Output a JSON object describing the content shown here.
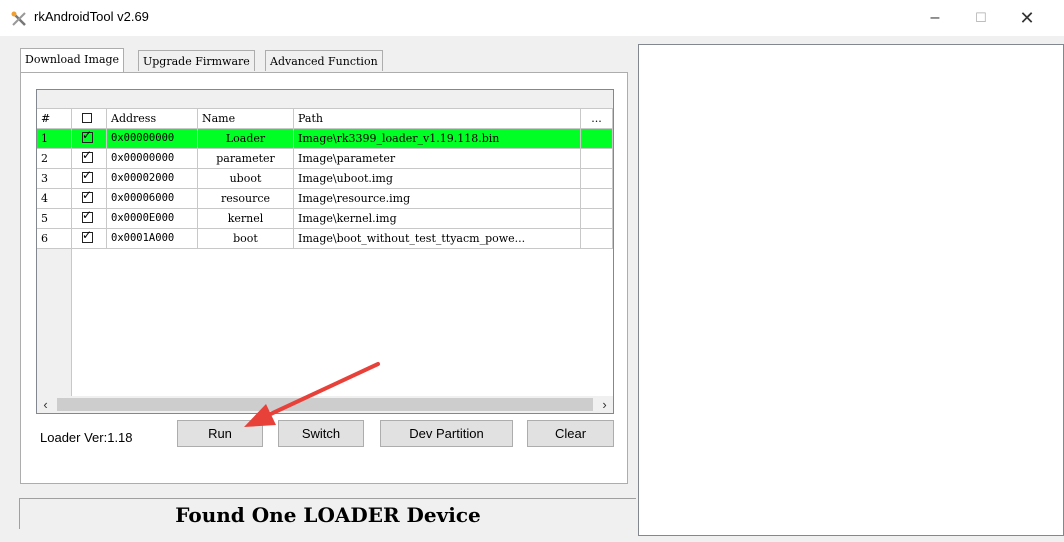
{
  "window": {
    "title": "rkAndroidTool v2.69",
    "controls": {
      "minimize": "–",
      "maximize": "☐",
      "close": "✕"
    }
  },
  "tabs": [
    {
      "label": "Download Image",
      "active": true
    },
    {
      "label": "Upgrade Firmware",
      "active": false
    },
    {
      "label": "Advanced Function",
      "active": false
    }
  ],
  "table": {
    "headers": {
      "num": "#",
      "address": "Address",
      "name": "Name",
      "path": "Path",
      "more": "..."
    },
    "rows": [
      {
        "num": "1",
        "checked": true,
        "address": "0x00000000",
        "name": "Loader",
        "path": "Image\\rk3399_loader_v1.19.118.bin",
        "selected": true
      },
      {
        "num": "2",
        "checked": true,
        "address": "0x00000000",
        "name": "parameter",
        "path": "Image\\parameter",
        "selected": false
      },
      {
        "num": "3",
        "checked": true,
        "address": "0x00002000",
        "name": "uboot",
        "path": "Image\\uboot.img",
        "selected": false
      },
      {
        "num": "4",
        "checked": true,
        "address": "0x00006000",
        "name": "resource",
        "path": "Image\\resource.img",
        "selected": false
      },
      {
        "num": "5",
        "checked": true,
        "address": "0x0000E000",
        "name": "kernel",
        "path": "Image\\kernel.img",
        "selected": false
      },
      {
        "num": "6",
        "checked": true,
        "address": "0x0001A000",
        "name": "boot",
        "path": "Image\\boot_without_test_ttyacm_powe...",
        "selected": false
      }
    ]
  },
  "loader_version": "Loader Ver:1.18",
  "buttons": {
    "run": "Run",
    "switch": "Switch",
    "dev_partition": "Dev Partition",
    "clear": "Clear"
  },
  "status": "Found One LOADER Device",
  "colors": {
    "selected_row": "#00ff24",
    "annotation_arrow": "#e8413a"
  },
  "icons": {
    "app": "tools-icon",
    "scroll_left": "chevron-left-icon",
    "scroll_right": "chevron-right-icon",
    "check": "checkmark-icon"
  }
}
